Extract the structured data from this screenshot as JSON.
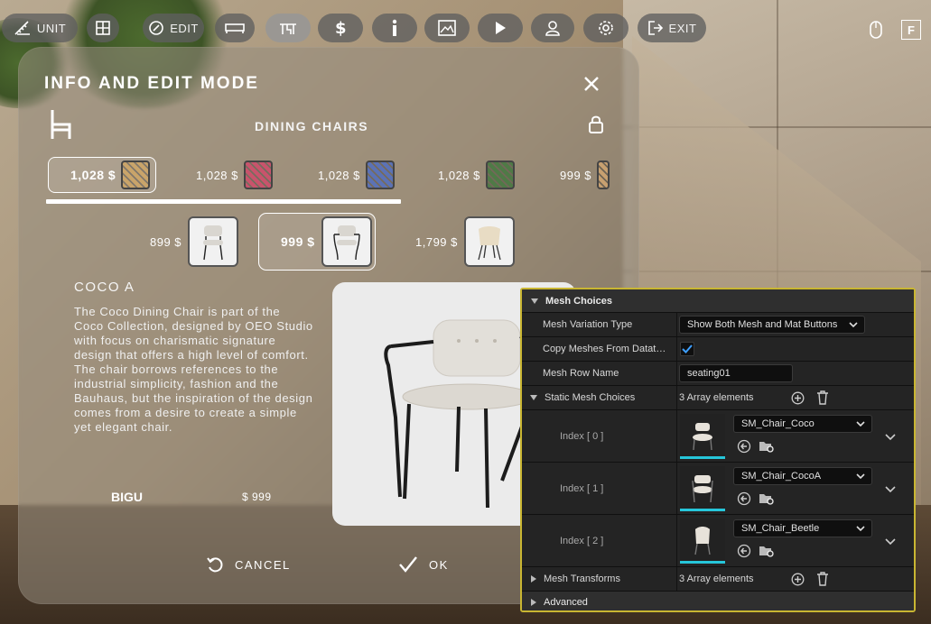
{
  "toolbar": {
    "unit_label": "UNIT",
    "edit_label": "EDIT",
    "exit_label": "EXIT",
    "fullscreen_key": "F",
    "icons": [
      "unit-ruler-icon",
      "grid-icon",
      "edit-palette-icon",
      "bed-icon",
      "table-icon",
      "dollar-icon",
      "info-icon",
      "image-icon",
      "play-icon",
      "user-icon",
      "gear-icon",
      "exit-icon",
      "mouse-icon"
    ]
  },
  "dialog": {
    "title": "INFO AND EDIT MODE",
    "category": "DINING CHAIRS",
    "materials": [
      {
        "price": "1,028 $",
        "color": "#c9a46a",
        "selected": true
      },
      {
        "price": "1,028 $",
        "color": "#c9536c",
        "selected": false
      },
      {
        "price": "1,028 $",
        "color": "#5b72b6",
        "selected": false
      },
      {
        "price": "1,028 $",
        "color": "#4f7a46",
        "selected": false
      },
      {
        "price": "999 $",
        "color": "#c7a070",
        "selected": false
      }
    ],
    "meshes": [
      {
        "price": "899 $",
        "selected": false
      },
      {
        "price": "999 $",
        "selected": true
      },
      {
        "price": "1,799 $",
        "selected": false
      }
    ],
    "product_name": "COCO A",
    "description": "The Coco Dining Chair is part of the Coco Collection, designed by OEO Studio with focus on charismatic signature design that offers a high level of comfort. The chair borrows references to the industrial simplicity, fashion and the Bauhaus, but the inspiration of the design comes from a desire to create a simple yet elegant chair.",
    "brand": "BIGU",
    "price": "$ 999",
    "cancel_label": "CANCEL",
    "ok_label": "OK"
  },
  "details": {
    "section_title": "Mesh Choices",
    "mesh_variation_type_label": "Mesh Variation Type",
    "mesh_variation_type_value": "Show Both Mesh and Mat Buttons",
    "copy_meshes_label": "Copy Meshes From Datat…",
    "copy_meshes_checked": true,
    "mesh_row_name_label": "Mesh Row Name",
    "mesh_row_name_value": "seating01",
    "static_mesh_choices_label": "Static Mesh Choices",
    "static_mesh_choices_count": "3 Array elements",
    "indices": [
      {
        "label": "Index [ 0 ]",
        "value": "SM_Chair_Coco"
      },
      {
        "label": "Index [ 1 ]",
        "value": "SM_Chair_CocoA"
      },
      {
        "label": "Index [ 2 ]",
        "value": "SM_Chair_Beetle"
      }
    ],
    "mesh_transforms_label": "Mesh Transforms",
    "mesh_transforms_count": "3 Array elements",
    "advanced_label": "Advanced",
    "accent_color": "#c9b632",
    "thumb_accent": "#26c6da"
  }
}
